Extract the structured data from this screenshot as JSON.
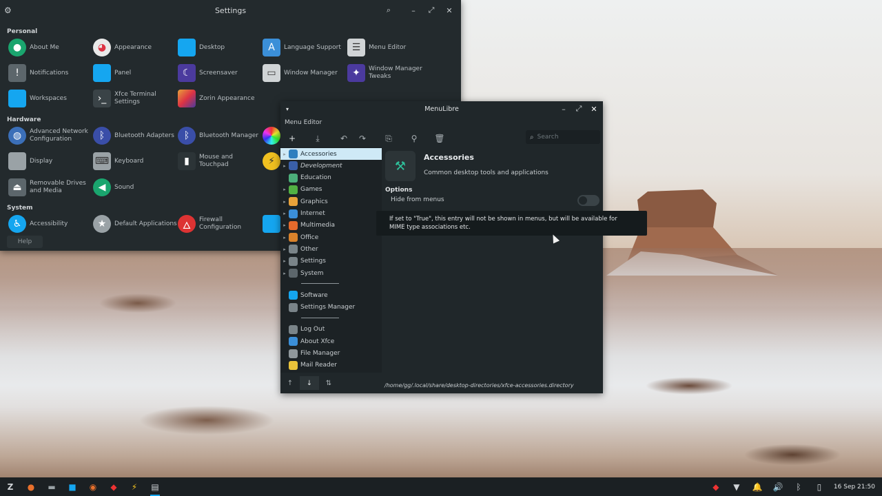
{
  "settings": {
    "title": "Settings",
    "sections": {
      "personal": "Personal",
      "hardware": "Hardware",
      "system": "System"
    },
    "items": {
      "about_me": "About Me",
      "appearance": "Appearance",
      "desktop": "Desktop",
      "language_support": "Language Support",
      "menu_editor": "Menu Editor",
      "notifications": "Notifications",
      "panel": "Panel",
      "screensaver": "Screensaver",
      "window_manager": "Window Manager",
      "window_manager_tweaks": "Window Manager Tweaks",
      "workspaces": "Workspaces",
      "xfce_terminal_settings": "Xfce Terminal Settings",
      "zorin_appearance": "Zorin Appearance",
      "advanced_network": "Advanced Network Configuration",
      "bluetooth_adapters": "Bluetooth Adapters",
      "bluetooth_manager": "Bluetooth Manager",
      "display": "Display",
      "keyboard": "Keyboard",
      "mouse_touchpad": "Mouse and Touchpad",
      "removable_drives": "Removable Drives and Media",
      "sound": "Sound",
      "accessibility": "Accessibility",
      "default_applications": "Default Applications",
      "firewall": "Firewall Configuration"
    },
    "help": "Help"
  },
  "menulibre": {
    "title": "MenuLibre",
    "subtitle": "Menu Editor",
    "search_placeholder": "Search",
    "tree": [
      {
        "label": "Accessories",
        "expandable": true,
        "selected": true,
        "color": "#2f7fbf"
      },
      {
        "label": "Development",
        "expandable": true,
        "italic": true,
        "color": "#3a5fa8"
      },
      {
        "label": "Education",
        "expandable": false,
        "color": "#4caf7a"
      },
      {
        "label": "Games",
        "expandable": true,
        "color": "#52b043"
      },
      {
        "label": "Graphics",
        "expandable": true,
        "color": "#e8a23a"
      },
      {
        "label": "Internet",
        "expandable": true,
        "color": "#3b8fd8"
      },
      {
        "label": "Multimedia",
        "expandable": true,
        "color": "#e46a2c"
      },
      {
        "label": "Office",
        "expandable": true,
        "color": "#d9822b"
      },
      {
        "label": "Other",
        "expandable": true,
        "color": "#7a8489"
      },
      {
        "label": "Settings",
        "expandable": true,
        "color": "#7a8489"
      },
      {
        "label": "System",
        "expandable": true,
        "color": "#5c666b"
      }
    ],
    "tree_extra": [
      {
        "label": "Software",
        "color": "#15a6f0"
      },
      {
        "label": "Settings Manager",
        "color": "#7a8489"
      }
    ],
    "tree_actions": [
      {
        "label": "Log Out",
        "color": "#7a8489"
      },
      {
        "label": "About Xfce",
        "color": "#3b8fd8"
      },
      {
        "label": "File Manager",
        "color": "#8f979b"
      },
      {
        "label": "Mail Reader",
        "color": "#e8c23a"
      }
    ],
    "detail": {
      "name": "Accessories",
      "comment": "Common desktop tools and applications",
      "options_header": "Options",
      "hide_from_menus": "Hide from menus",
      "hide_from_menus_value": false,
      "path": "/home/gg/.local/share/desktop-directories/xfce-accessories.directory"
    },
    "tooltip": "If set to \"True\", this entry will not be shown in menus, but will be available for MIME type associations etc."
  },
  "taskbar": {
    "clock": "16 Sep 21:50"
  }
}
